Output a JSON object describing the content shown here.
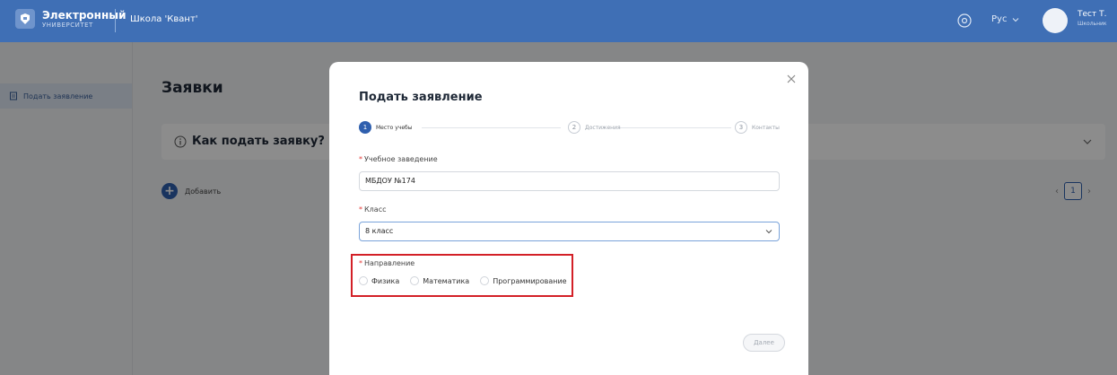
{
  "header": {
    "logo_title": "Электронный",
    "logo_subtitle": "УНИВЕРСИТЕТ",
    "school": "Школа 'Квант'",
    "language": "Рус",
    "user_name": "Тест Т.",
    "user_role": "Школьник",
    "bg_color": "#3f6fb5"
  },
  "sidebar": {
    "items": [
      {
        "label": "Подать заявление",
        "icon": "document-icon"
      }
    ]
  },
  "main": {
    "title": "Заявки",
    "accordion_title": "Как подать заявку?",
    "add_label": "Добавить",
    "pagination_current": "1"
  },
  "modal": {
    "title": "Подать заявление",
    "steps": [
      {
        "number": "1",
        "label": "Место учебы",
        "active": true
      },
      {
        "number": "2",
        "label": "Достижения",
        "active": false
      },
      {
        "number": "3",
        "label": "Контакты",
        "active": false
      }
    ],
    "institution": {
      "required_mark": "*",
      "label": "Учебное заведение",
      "value": "МБДОУ №174"
    },
    "grade": {
      "required_mark": "*",
      "label": "Класс",
      "value": "8 класс"
    },
    "direction": {
      "required_mark": "*",
      "label": "Направление",
      "options": [
        "Физика",
        "Математика",
        "Программирование"
      ]
    },
    "next_label": "Далее",
    "accent_color": "#2f5fae",
    "highlight_color": "#d32027"
  }
}
